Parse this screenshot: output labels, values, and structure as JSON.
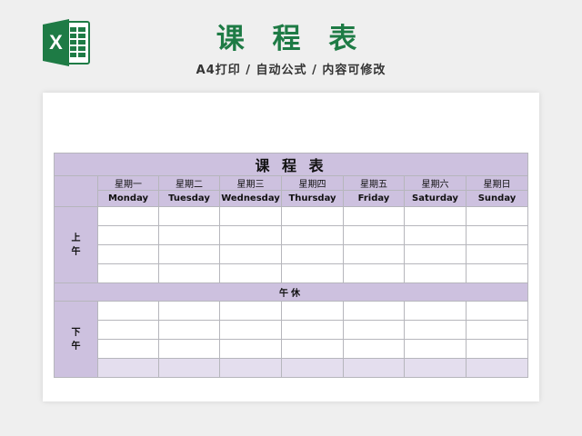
{
  "header": {
    "title": "课 程 表",
    "subtitle": "A4打印 / 自动公式 / 内容可修改"
  },
  "app_icon": {
    "name": "excel-icon",
    "letter": "X",
    "color": "#1e7b45"
  },
  "schedule": {
    "title": "课 程 表",
    "days_cn": [
      "星期一",
      "星期二",
      "星期三",
      "星期四",
      "星期五",
      "星期六",
      "星期日"
    ],
    "days_en": [
      "Monday",
      "Tuesday",
      "Wednesday",
      "Thursday",
      "Friday",
      "Saturday",
      "Sunday"
    ],
    "morning_label": "上午",
    "morning_rows": 4,
    "lunch_label": "午休",
    "afternoon_label": "下午",
    "afternoon_rows": 4
  },
  "colors": {
    "header_purple": "#cdc1df",
    "light_purple": "#e4deee",
    "title_green": "#1e7b45",
    "background": "#efefef"
  }
}
